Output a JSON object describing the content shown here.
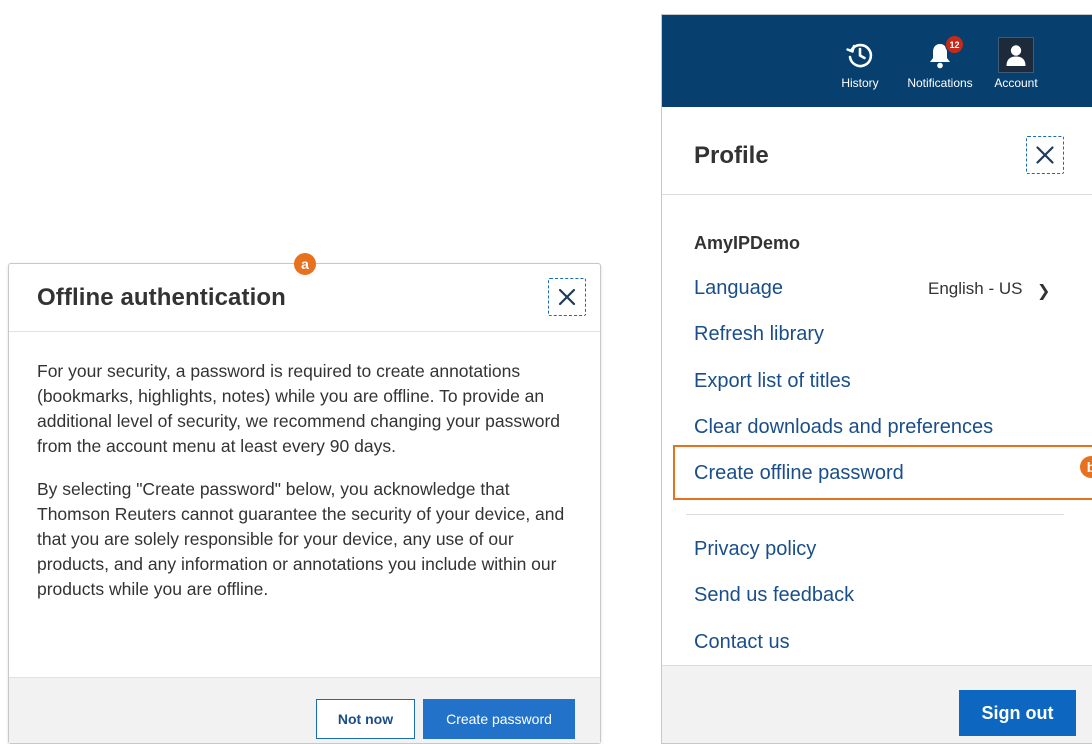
{
  "markers": {
    "a": "a",
    "b": "b"
  },
  "dialog": {
    "title": "Offline authentication",
    "paragraphs": [
      "For your security, a password is required to create annotations (bookmarks, highlights, notes) while you are offline. To provide an additional level of security, we recommend changing your password from the account menu at least every 90 days.",
      "By selecting \"Create password\" below, you acknowledge that Thomson Reuters cannot guarantee the security of your device, and that you are solely responsible for your device, any use of our products, and any information or annotations you include within our products while you are offline."
    ],
    "secondary_button": "Not now",
    "primary_button": "Create password",
    "close_icon": "close-icon"
  },
  "topbar": {
    "history_label": "History",
    "notifications_label": "Notifications",
    "notifications_count": "12",
    "account_label": "Account"
  },
  "profile": {
    "title": "Profile",
    "username": "AmyIPDemo",
    "language_label": "Language",
    "language_value": "English - US",
    "items": [
      "Refresh library",
      "Export list of titles",
      "Clear downloads and preferences",
      "Create offline password"
    ],
    "secondary_items": [
      "Privacy policy",
      "Send us feedback",
      "Contact us"
    ],
    "sign_out": "Sign out"
  },
  "colors": {
    "accent_blue": "#2272c9",
    "topbar_navy": "#07406f",
    "highlight_orange": "#e8711f",
    "badge_red": "#c52a1a"
  }
}
